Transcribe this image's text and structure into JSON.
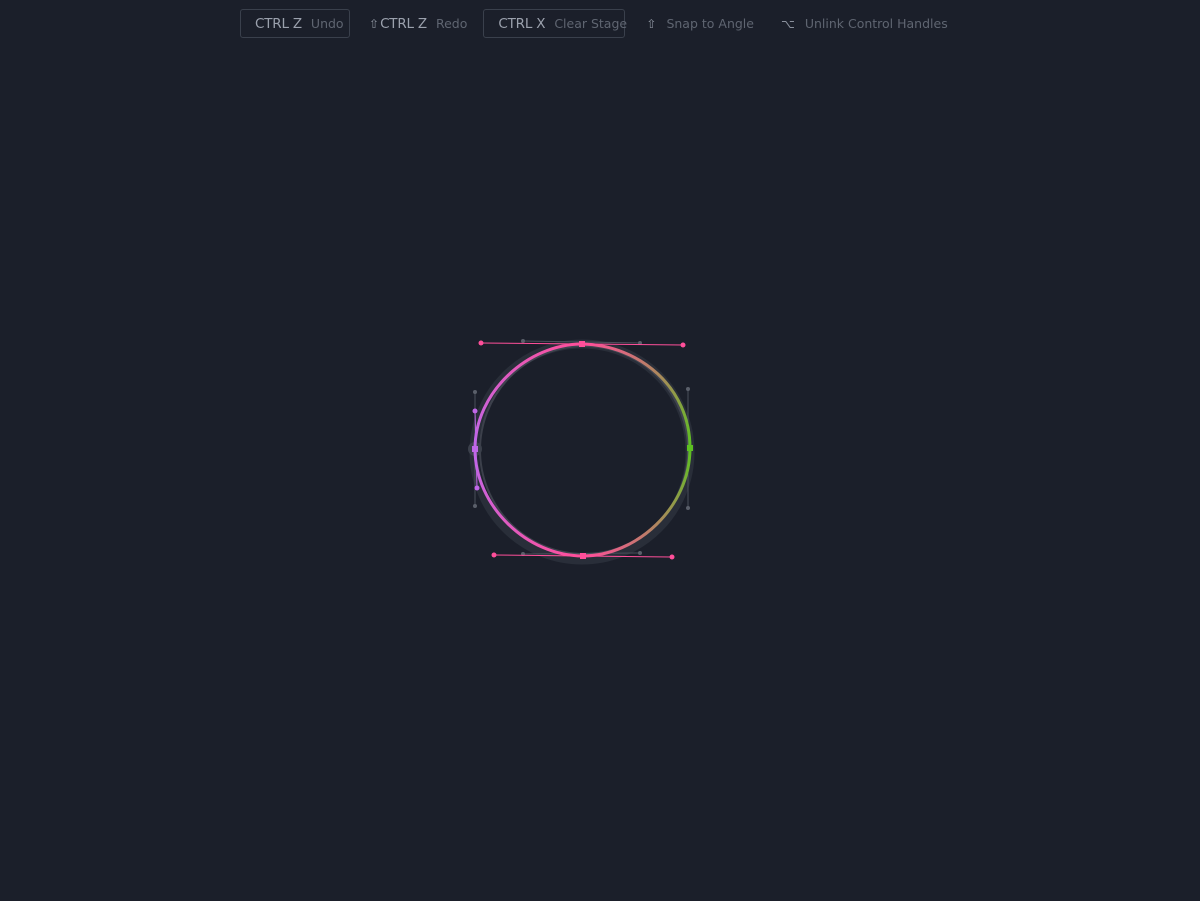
{
  "toolbar": {
    "undo": {
      "key": "CTRL Z",
      "label": "Undo"
    },
    "redo": {
      "glyph": "⇧",
      "key": "CTRL Z",
      "label": "Redo"
    },
    "clear": {
      "key": "CTRL X",
      "label": "Clear Stage"
    },
    "snap": {
      "glyph": "⇧",
      "label": "Snap to Angle"
    },
    "unlink": {
      "glyph": "⌥",
      "label": "Unlink Control Handles"
    }
  },
  "colors": {
    "background": "#1b1f2a",
    "pink": "#ff4f9a",
    "green": "#5cc021",
    "purple": "#c067e8",
    "ghost": "#4a4f5a"
  }
}
